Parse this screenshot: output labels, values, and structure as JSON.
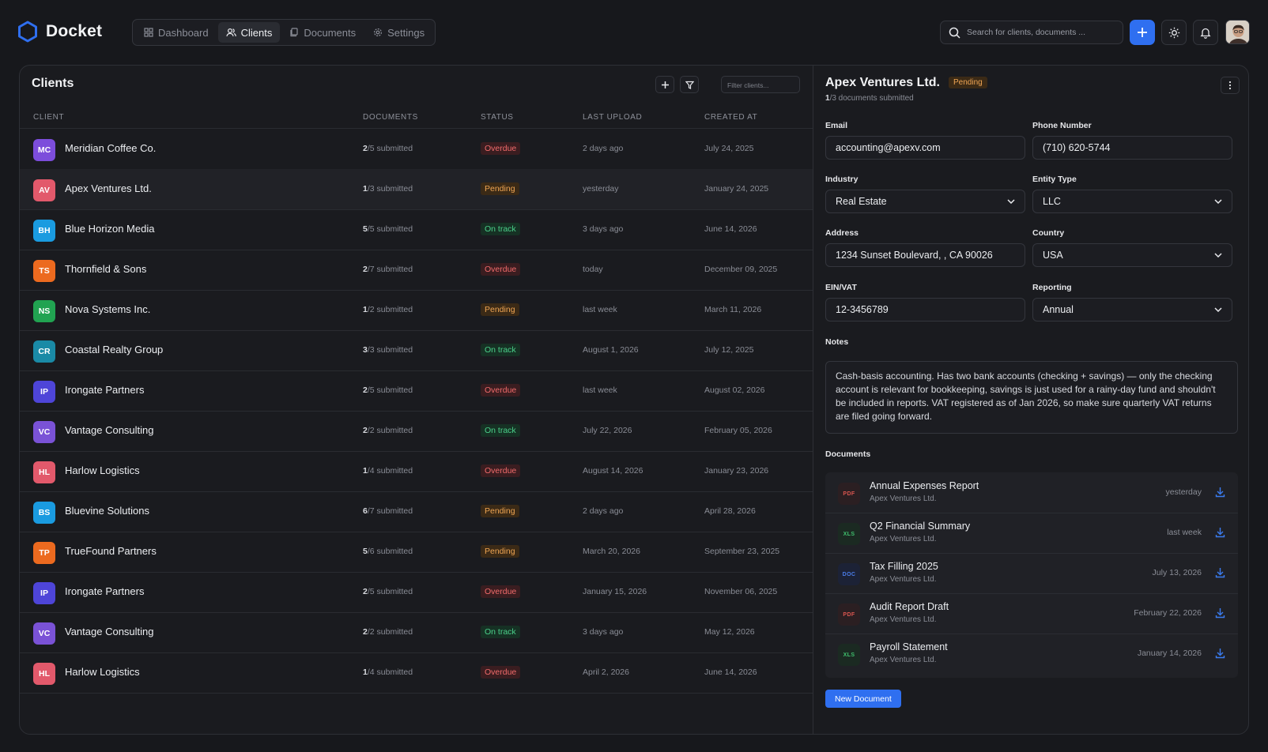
{
  "app": {
    "name": "Docket",
    "accent": "#2f6ff0"
  },
  "nav": [
    {
      "label": "Dashboard",
      "icon": "grid-icon"
    },
    {
      "label": "Clients",
      "icon": "users-icon",
      "active": true
    },
    {
      "label": "Documents",
      "icon": "documents-icon"
    },
    {
      "label": "Settings",
      "icon": "gear-icon"
    }
  ],
  "search": {
    "placeholder": "Search for clients, documents ..."
  },
  "clients": {
    "title": "Clients",
    "filter_placeholder": "Filter clients...",
    "columns": [
      "CLIENT",
      "DOCUMENTS",
      "STATUS",
      "LAST UPLOAD",
      "CREATED AT"
    ],
    "rows": [
      {
        "initials": "MC",
        "color": "#7c4ddb",
        "name": "Meridian Coffee Co.",
        "docs_done": "2",
        "docs_total": "/5 submitted",
        "status": "Overdue",
        "last": "2 days ago",
        "created": "July 24, 2025"
      },
      {
        "initials": "AV",
        "color": "#e2596b",
        "name": "Apex Ventures Ltd.",
        "docs_done": "1",
        "docs_total": "/3 submitted",
        "status": "Pending",
        "last": "yesterday",
        "created": "January 24, 2025"
      },
      {
        "initials": "BH",
        "color": "#1a9be0",
        "name": "Blue Horizon Media",
        "docs_done": "5",
        "docs_total": "/5 submitted",
        "status": "On track",
        "last": "3 days ago",
        "created": "June 14, 2026"
      },
      {
        "initials": "TS",
        "color": "#ec6a1f",
        "name": "Thornfield & Sons",
        "docs_done": "2",
        "docs_total": "/7 submitted",
        "status": "Overdue",
        "last": "today",
        "created": "December 09, 2025"
      },
      {
        "initials": "NS",
        "color": "#21a351",
        "name": "Nova Systems Inc.",
        "docs_done": "1",
        "docs_total": "/2 submitted",
        "status": "Pending",
        "last": "last week",
        "created": "March  11, 2026"
      },
      {
        "initials": "CR",
        "color": "#1a8aa6",
        "name": "Coastal Realty Group",
        "docs_done": "3",
        "docs_total": "/3 submitted",
        "status": "On track",
        "last": "August 1, 2026",
        "created": "July 12, 2025"
      },
      {
        "initials": "IP",
        "color": "#4e45d8",
        "name": "Irongate Partners",
        "docs_done": "2",
        "docs_total": "/5 submitted",
        "status": "Overdue",
        "last": "last week",
        "created": "August 02, 2026"
      },
      {
        "initials": "VC",
        "color": "#7a52d6",
        "name": "Vantage Consulting",
        "docs_done": "2",
        "docs_total": "/2 submitted",
        "status": "On track",
        "last": "July 22, 2026",
        "created": "February 05, 2026"
      },
      {
        "initials": "HL",
        "color": "#e2596b",
        "name": "Harlow Logistics",
        "docs_done": "1",
        "docs_total": "/4 submitted",
        "status": "Overdue",
        "last": "August 14, 2026",
        "created": "January 23, 2026"
      },
      {
        "initials": "BS",
        "color": "#1a9be0",
        "name": "Bluevine Solutions",
        "docs_done": "6",
        "docs_total": "/7 submitted",
        "status": "Pending",
        "last": "2 days ago",
        "created": "April 28, 2026"
      },
      {
        "initials": "TP",
        "color": "#ec6a1f",
        "name": "TrueFound Partners",
        "docs_done": "5",
        "docs_total": "/6 submitted",
        "status": "Pending",
        "last": "March 20, 2026",
        "created": "September 23, 2025"
      },
      {
        "initials": "IP",
        "color": "#4e45d8",
        "name": "Irongate Partners",
        "docs_done": "2",
        "docs_total": "/5 submitted",
        "status": "Overdue",
        "last": "January 15, 2026",
        "created": "November 06, 2025"
      },
      {
        "initials": "VC",
        "color": "#7a52d6",
        "name": "Vantage Consulting",
        "docs_done": "2",
        "docs_total": "/2 submitted",
        "status": "On track",
        "last": "3 days ago",
        "created": "May 12, 2026"
      },
      {
        "initials": "HL",
        "color": "#e2596b",
        "name": "Harlow Logistics",
        "docs_done": "1",
        "docs_total": "/4 submitted",
        "status": "Overdue",
        "last": "April 2, 2026",
        "created": "June 14, 2026"
      }
    ]
  },
  "detail": {
    "title": "Apex Ventures Ltd.",
    "badge": "Pending",
    "sub_done": "1",
    "sub_rest": "/3 documents submitted",
    "email_label": "Email",
    "email": "accounting@apexv.com",
    "phone_label": "Phone Number",
    "phone": "(710) 620-5744",
    "industry_label": "Industry",
    "industry": "Real Estate",
    "entity_label": "Entity Type",
    "entity": "LLC",
    "address_label": "Address",
    "address": "1234 Sunset Boulevard, , CA 90026",
    "country_label": "Country",
    "country": "USA",
    "ein_label": "EIN/VAT",
    "ein": "12-3456789",
    "reporting_label": "Reporting",
    "reporting": "Annual",
    "notes_label": "Notes",
    "notes": "Cash-basis accounting. Has two bank accounts (checking + savings) — only the checking account is relevant for bookkeeping, savings is just used for a rainy-day fund and shouldn't be included in reports. VAT registered as of Jan 2026, so make sure quarterly VAT returns are filed going forward.",
    "documents_label": "Documents",
    "documents": [
      {
        "type": "PDF",
        "name": "Annual Expenses Report",
        "owner": "Apex Ventures Ltd.",
        "date": "yesterday"
      },
      {
        "type": "XLS",
        "name": "Q2 Financial Summary",
        "owner": "Apex Ventures Ltd.",
        "date": "last week"
      },
      {
        "type": "DOC",
        "name": "Tax Filling 2025",
        "owner": "Apex Ventures Ltd.",
        "date": "July 13, 2026"
      },
      {
        "type": "PDF",
        "name": "Audit Report Draft",
        "owner": "Apex Ventures Ltd.",
        "date": "February 22, 2026"
      },
      {
        "type": "XLS",
        "name": "Payroll Statement",
        "owner": "Apex Ventures Ltd.",
        "date": "January 14, 2026"
      }
    ],
    "new_document_label": "New Document"
  }
}
